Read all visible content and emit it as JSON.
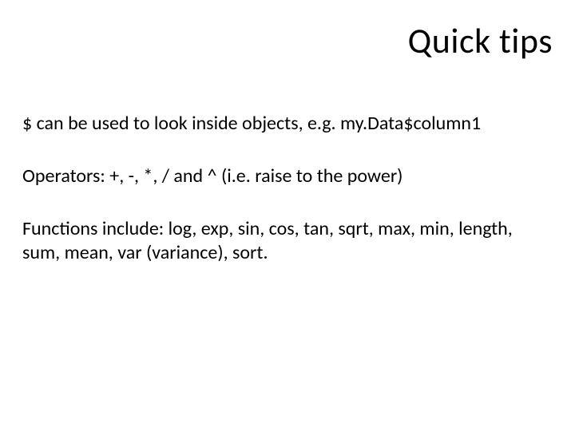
{
  "slide": {
    "title": "Quick tips",
    "paragraphs": [
      "$ can be used to look inside objects, e.g. my.Data$column1",
      "Operators: +, -, *, / and ^ (i.e. raise to the power)",
      "Functions include: log, exp, sin, cos, tan, sqrt, max, min, length, sum, mean, var (variance), sort."
    ]
  }
}
